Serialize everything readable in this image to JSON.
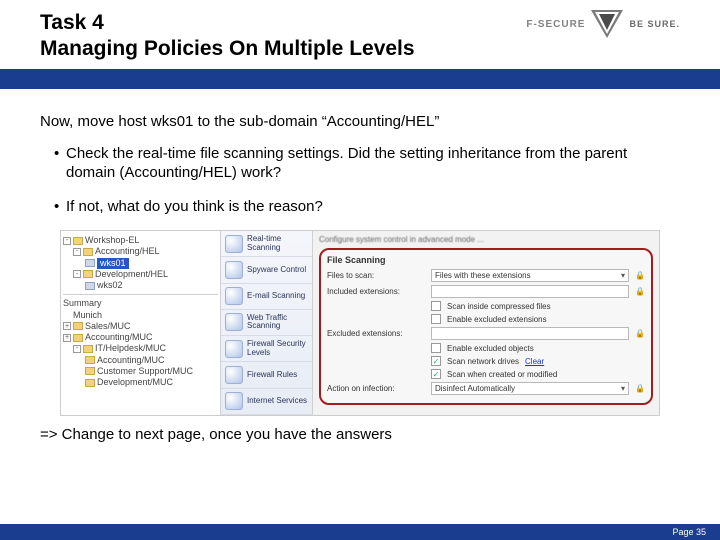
{
  "header": {
    "task_line": "Task 4",
    "title_line": "Managing Policies On Multiple Levels",
    "logo_text": "F-SECURE",
    "tagline": "BE SURE."
  },
  "content": {
    "lead": "Now, move host wks01 to the sub-domain “Accounting/HEL”",
    "bullet1": "Check the real-time file scanning settings. Did the setting inheritance from the parent domain (Accounting/HEL) work?",
    "bullet2": "If not, what do you think is the reason?",
    "closing": "=> Change to next page, once you have the answers"
  },
  "tree": {
    "root": "Workshop-EL",
    "n1": "Accounting/HEL",
    "n1_sel": "wks01",
    "n2": "Development/HEL",
    "n2_c": "wks02",
    "summary_label": "Summary",
    "summary_sub": "Munich",
    "m1": "Sales/MUC",
    "m2": "Accounting/MUC",
    "m3": "IT/Helpdesk/MUC",
    "m4": "Accounting/MUC",
    "m5": "Customer Support/MUC",
    "m6": "Development/MUC"
  },
  "side": {
    "s1": "Real-time Scanning",
    "s2": "Spyware Control",
    "s3": "E-mail Scanning",
    "s4": "Web Traffic Scanning",
    "s5": "Firewall Security Levels",
    "s6": "Firewall Rules",
    "s7": "Internet Services"
  },
  "panel": {
    "config_hint": "Configure system control in advanced mode ...",
    "title": "File Scanning",
    "row1_label": "Files to scan:",
    "row1_value": "Files with these extensions",
    "row2_label": "Included extensions:",
    "row2_value": "",
    "cb1": "Scan inside compressed files",
    "cb2": "Enable excluded extensions",
    "sub_excluded": "Excluded extensions:",
    "cb3": "Enable excluded objects",
    "cb4": "Scan network drives",
    "cb4_link": "Clear",
    "cb5": "Scan when created or modified",
    "row_action_label": "Action on infection:",
    "row_action_value": "Disinfect Automatically"
  },
  "footer": {
    "page": "Page 35"
  }
}
